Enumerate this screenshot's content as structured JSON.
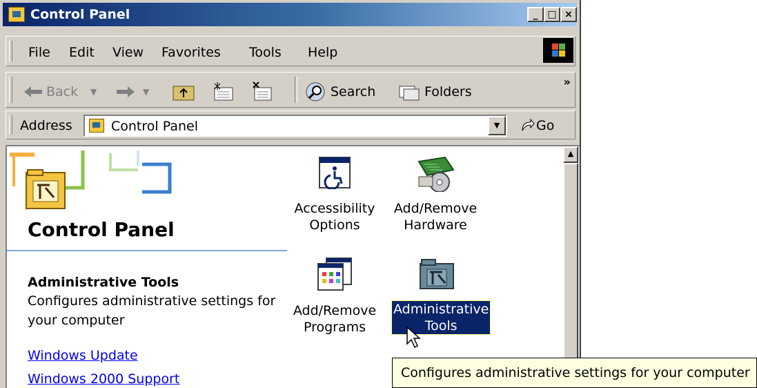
{
  "window": {
    "title": "Control Panel",
    "controls": {
      "minimize": "_",
      "maximize": "□",
      "close": "×"
    }
  },
  "menu": {
    "items": [
      "File",
      "Edit",
      "View",
      "Favorites",
      "Tools",
      "Help"
    ]
  },
  "toolbar": {
    "back_label": "Back",
    "search_label": "Search",
    "folders_label": "Folders",
    "overflow": "»"
  },
  "address": {
    "label": "Address",
    "value": "Control Panel",
    "go_label": "Go"
  },
  "leftpane": {
    "heading": "Control Panel",
    "selected_title": "Administrative Tools",
    "selected_desc": "Configures administrative settings for your computer",
    "links": [
      "Windows Update",
      "Windows 2000 Support"
    ]
  },
  "icons": [
    {
      "label_line1": "Accessibility",
      "label_line2": "Options",
      "icon": "accessibility-icon"
    },
    {
      "label_line1": "Add/Remove",
      "label_line2": "Hardware",
      "icon": "hardware-icon"
    },
    {
      "label_line1": "Add/Remove",
      "label_line2": "Programs",
      "icon": "programs-icon"
    },
    {
      "label_line1": "Administrative",
      "label_line2": "Tools",
      "icon": "admin-tools-icon",
      "selected": true
    }
  ],
  "tooltip": "Configures administrative settings for your computer",
  "colors": {
    "title_start": "#0a246a",
    "title_end": "#a6caf0",
    "selection": "#0a246a",
    "link": "#0000ee",
    "tooltip_bg": "#ffffe1"
  }
}
